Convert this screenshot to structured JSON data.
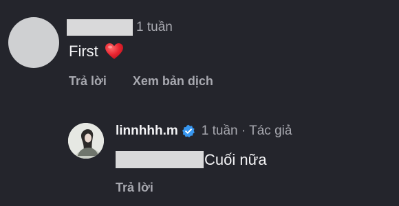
{
  "comment": {
    "time": "1 tuần",
    "text": "First",
    "reaction_icon": "red-heart-emoji",
    "actions": {
      "reply": "Trả lời",
      "translate": "Xem bản dịch"
    }
  },
  "reply": {
    "username": "linnhhh.m",
    "verified_icon": "verified-badge-icon",
    "meta": "1 tuần · Tác giả",
    "text": "Cuối nữa",
    "actions": {
      "reply": "Trả lời"
    }
  },
  "colors": {
    "background": "#24252c",
    "primary_text": "#f4f4f6",
    "secondary_text": "#a8a9b0",
    "verified_blue": "#3897f0",
    "heart_red": "#e8232f",
    "redaction": "#d9d9da"
  }
}
